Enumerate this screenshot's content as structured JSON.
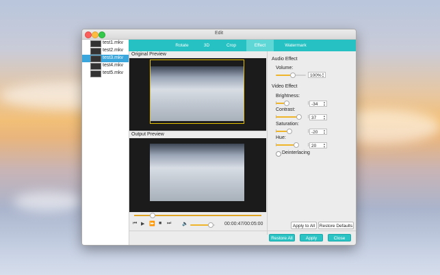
{
  "window": {
    "title": "Edit"
  },
  "files": [
    {
      "name": "test1.mkv",
      "selected": false
    },
    {
      "name": "test2.mkv",
      "selected": false
    },
    {
      "name": "test3.mkv",
      "selected": true
    },
    {
      "name": "test4.mkv",
      "selected": false
    },
    {
      "name": "test5.mkv",
      "selected": false
    }
  ],
  "tabs": [
    {
      "label": "Rotate",
      "active": false
    },
    {
      "label": "3D",
      "active": false
    },
    {
      "label": "Crop",
      "active": false
    },
    {
      "label": "Effect",
      "active": true
    },
    {
      "label": "Watermark",
      "active": false
    }
  ],
  "preview": {
    "original_label": "Original Preview",
    "output_label": "Output Preview",
    "progress_fraction": 0.14,
    "time": "00:00:47/00:05:00",
    "volume_fraction": 0.8
  },
  "audio": {
    "title": "Audio Effect",
    "volume_label": "Volume:",
    "volume_value": "100%",
    "volume_fraction": 0.55
  },
  "video": {
    "title": "Video Effect",
    "brightness_label": "Brightness:",
    "brightness_value": "-34",
    "contrast_label": "Contrast:",
    "contrast_value": "37",
    "saturation_label": "Saturation:",
    "saturation_value": "-20",
    "hue_label": "Hue:",
    "hue_value": "20",
    "deinterlacing_label": "Deinterlacing"
  },
  "buttons": {
    "apply_to_all": "Apply to All",
    "restore_defaults": "Restore Defaults",
    "restore_all": "Restore All",
    "apply": "Apply",
    "close": "Close"
  },
  "colors": {
    "accent": "#26c1c2",
    "selection": "#3aa6dc",
    "slider_fill": "#f0b429",
    "crop_outline": "#e6c200"
  }
}
